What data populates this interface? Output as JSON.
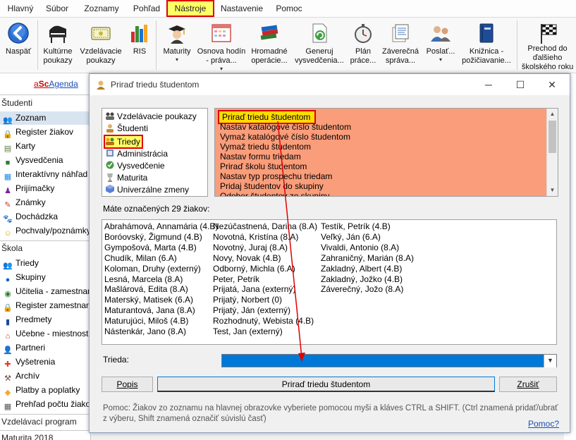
{
  "menu": {
    "items": [
      "Hlavný",
      "Súbor",
      "Zoznamy",
      "Pohľad",
      "Nástroje",
      "Nastavenie",
      "Pomoc"
    ],
    "active_index": 4
  },
  "ribbon": {
    "back": "Naspäť",
    "buttons": [
      {
        "l1": "Kultúrne",
        "l2": "poukazy",
        "dd": false
      },
      {
        "l1": "Vzdelávacie",
        "l2": "poukazy",
        "dd": false
      },
      {
        "l1": "RIS",
        "l2": "",
        "dd": false
      },
      {
        "l1": "Maturity",
        "l2": "",
        "dd": true
      },
      {
        "l1": "Osnova hodín",
        "l2": "- práva...",
        "dd": true
      },
      {
        "l1": "Hromadné",
        "l2": "operácie...",
        "dd": false
      },
      {
        "l1": "Generuj",
        "l2": "vysvedčenia...",
        "dd": false
      },
      {
        "l1": "Plán",
        "l2": "práce...",
        "dd": false
      },
      {
        "l1": "Záverečná",
        "l2": "správa...",
        "dd": false
      },
      {
        "l1": "Poslať...",
        "l2": "",
        "dd": true
      },
      {
        "l1": "Knižnica -",
        "l2": "požičiavanie...",
        "dd": false
      },
      {
        "l1": "Prechod do",
        "l2": "ďalšieho",
        "l3": "školského roku",
        "dd": false
      }
    ]
  },
  "sidebar": {
    "brand_a": "a",
    "brand_sc": "Sc",
    "brand_rest": "Agenda",
    "section_students": "Študenti",
    "students_items": [
      "Zoznam",
      "Register žiakov",
      "Karty",
      "Vysvedčenia",
      "Interaktívny náhľad",
      "Prijímačky",
      "Známky",
      "Dochádzka",
      "Pochvaly/poznámky"
    ],
    "section_school": "Škola",
    "school_items": [
      "Triedy",
      "Skupiny",
      "Učitelia - zamestnanci",
      "Register zamestnancov",
      "Predmety",
      "Učebne - miestnosti",
      "Partneri",
      "Vyšetrenia",
      "Archív",
      "Platby a poplatky",
      "Prehľad počtu žiakov"
    ],
    "section_program": "Vzdelávací program",
    "section_bottom": "Maturita 2018"
  },
  "dialog": {
    "title": "Priraď triedu študentom",
    "categories": [
      "Vzdelávacie poukazy",
      "Študenti",
      "Triedy",
      "Administrácia",
      "Vysvedčenie",
      "Maturita",
      "Univerzálne zmeny"
    ],
    "selected_category": "Triedy",
    "actions": [
      "Priraď triedu študentom",
      "Nastav katalógové číslo študentom",
      "Vymaž katalógové číslo študentom",
      "Vymaž triedu študentom",
      "Nastav formu triedam",
      "Priraď školu študentom",
      "Nastav typ prospechu triedam",
      "Pridaj študentov do skupiny",
      "Odober študentov zo skupiny"
    ],
    "selected_action": "Priraď triedu študentom",
    "marked_label": "Máte označených 29 žiakov:",
    "students": [
      [
        "Abrahámová, Annamária (4.B)",
        "Boróovský, Žigmund (4.B)",
        "Gympošová, Marta (4.B)",
        "Chudík, Milan (6.A)",
        "Koloman, Druhy (externý)",
        "Lesná, Marcela (8.A)",
        "Mašlárová, Edita (8.A)",
        "Materský, Matisek (6.A)",
        "Maturantová, Jana (8.A)",
        "Maturujúci, Miloš (4.B)",
        "Nástenkár, Jano (8.A)"
      ],
      [
        "Nezúčastnená, Darina (8.A)",
        "Novotná, Kristína (8.A)",
        "Novotný, Juraj (8.A)",
        "Novy, Novak (4.B)",
        "Odborný, Michla (6.A)",
        "Peter, Petrík",
        "Prijatá, Jana (externý)",
        "Prijatý, Norbert (0)",
        "Prijatý, Ján (externý)",
        "Rozhodnutý, Webista (4.B)",
        "Test, Jan (externý)"
      ],
      [
        "Testík, Petrík (4.B)",
        "Veľký, Ján (6.A)",
        "Vivaldi, Antonio (8.A)",
        "Zahraničný, Marián (8.A)",
        "Zakladný, Albert (4.B)",
        "Zakladný, Jožko (4.B)",
        "Záverečný, Jožo (8.A)"
      ]
    ],
    "trieda_label": "Trieda:",
    "trieda_value": "",
    "btn_popis": "Popis",
    "btn_assign": "Priraď triedu študentom",
    "btn_cancel": "Zrušiť",
    "help_text_1": "Pomoc: Žiakov zo zoznamu na hlavnej obrazovke vyberiete pomocou myši a kláves CTRL a SHIFT. (Ctrl znamená pridať/ubrať",
    "help_text_2": "z výberu, Shift znamená označiť súvislú časť)",
    "help_link": "Pomoc?"
  },
  "colors": {
    "highlight_red": "#e00000",
    "highlight_yellow": "#ffff66",
    "actions_bg": "#fa9d7a",
    "combo_blue": "#0078d7",
    "arrow_red": "#e00000"
  }
}
